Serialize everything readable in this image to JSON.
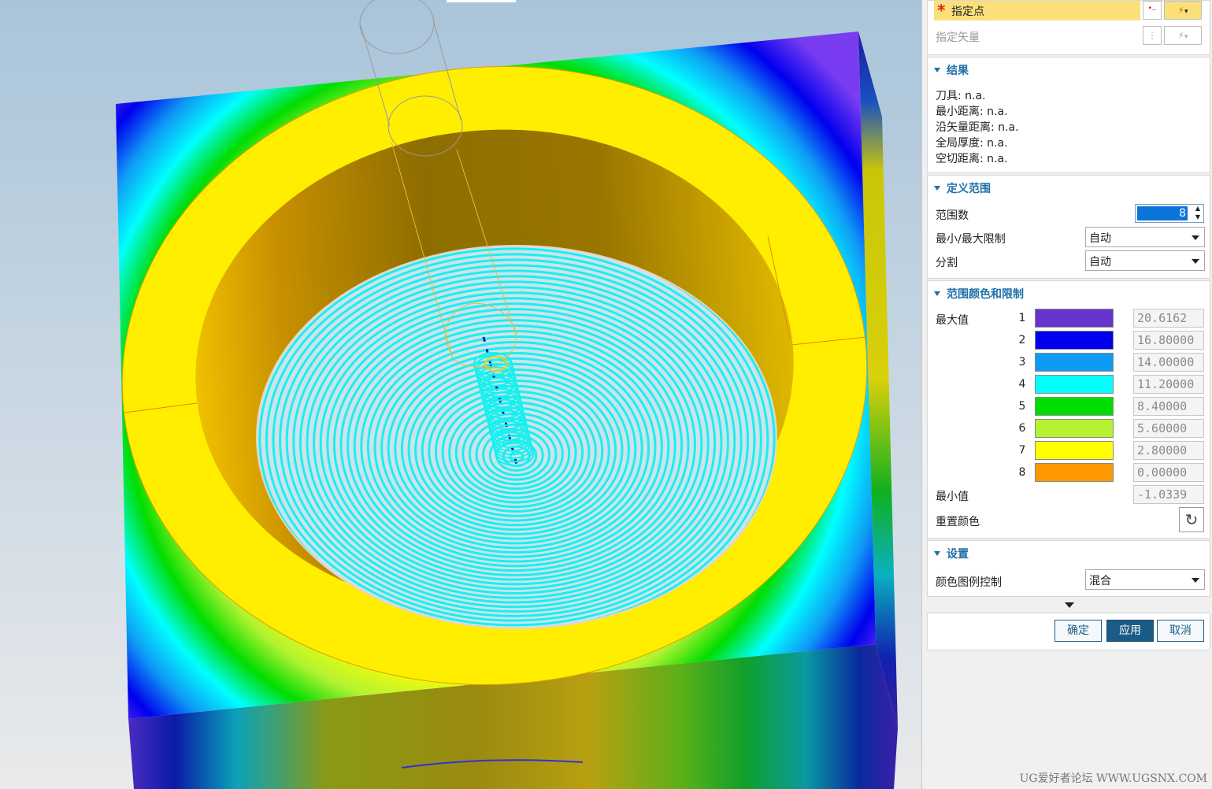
{
  "panel": {
    "specify_point_label": "指定点",
    "specify_vector_label": "指定矢量",
    "results": {
      "header": "结果",
      "lines": [
        "刀具: n.a.",
        "最小距离: n.a.",
        "沿矢量距离: n.a.",
        "全局厚度: n.a.",
        "空切距离: n.a."
      ]
    },
    "define_range": {
      "header": "定义范围",
      "count_label": "范围数",
      "count_value": "8",
      "minmax_label": "最小/最大限制",
      "minmax_value": "自动",
      "split_label": "分割",
      "split_value": "自动"
    },
    "range_colors": {
      "header": "范围颜色和限制",
      "max_label": "最大值",
      "min_label": "最小值",
      "min_value": "-1.0339",
      "reset_label": "重置颜色",
      "rows": [
        {
          "index": "1",
          "color": "#6633cc",
          "value": "20.6162"
        },
        {
          "index": "2",
          "color": "#0000ee",
          "value": "16.80000"
        },
        {
          "index": "3",
          "color": "#0f9af5",
          "value": "14.00000"
        },
        {
          "index": "4",
          "color": "#00ffff",
          "value": "11.20000"
        },
        {
          "index": "5",
          "color": "#00dd00",
          "value": "8.40000"
        },
        {
          "index": "6",
          "color": "#b4f232",
          "value": "5.60000"
        },
        {
          "index": "7",
          "color": "#ffff00",
          "value": "2.80000"
        },
        {
          "index": "8",
          "color": "#ff9900",
          "value": "0.00000"
        }
      ]
    },
    "settings": {
      "header": "设置",
      "legend_label": "颜色图例控制",
      "legend_value": "混合"
    },
    "buttons": {
      "ok": "确定",
      "apply": "应用",
      "cancel": "取消"
    }
  },
  "watermark": "UG爱好者论坛 WWW.UGSNX.COM",
  "colors": {
    "accent": "#1f6fa8",
    "required_star": "#e0201c",
    "highlight_row": "#fbe07a",
    "spinner_selected": "#0a74da"
  }
}
